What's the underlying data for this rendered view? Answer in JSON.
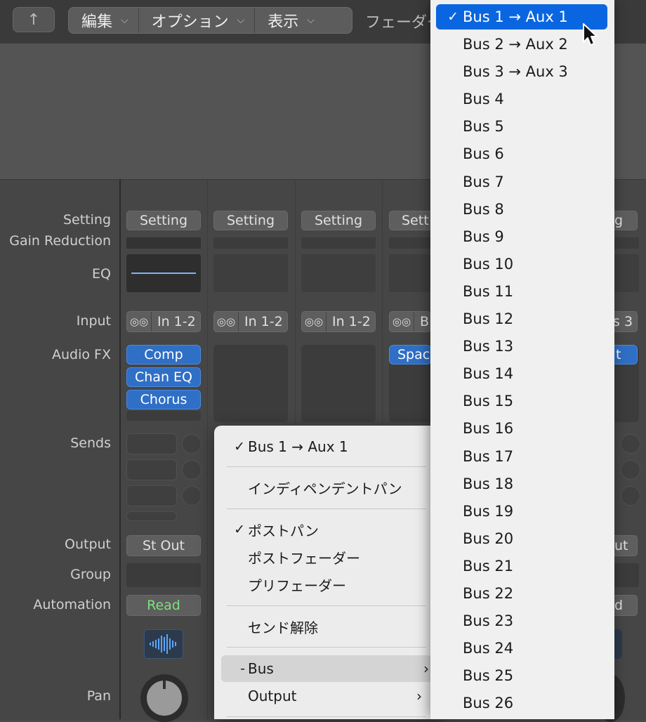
{
  "toolbar": {
    "back_icon": "↑",
    "menus": [
      {
        "label": "編集"
      },
      {
        "label": "オプション"
      },
      {
        "label": "表示"
      }
    ],
    "fader_label": "フェーダー"
  },
  "row_labels": {
    "setting": "Setting",
    "gain_reduction": "Gain Reduction",
    "eq": "EQ",
    "input": "Input",
    "audio_fx": "Audio FX",
    "sends": "Sends",
    "output": "Output",
    "group": "Group",
    "automation": "Automation",
    "pan": "Pan"
  },
  "strips": {
    "s1": {
      "setting": "Setting",
      "input": "In 1-2",
      "fx": [
        "Comp",
        "Chan EQ",
        "Chorus"
      ],
      "output": "St Out",
      "automation": "Read"
    },
    "s2": {
      "setting": "Setting",
      "input": "In 1-2"
    },
    "s3": {
      "setting": "Setting",
      "input": "In 1-2"
    },
    "s4": {
      "setting": "Setting",
      "input": "B",
      "fx": "Space"
    },
    "s5": {
      "setting": "g",
      "input": "s 3",
      "fx": "t",
      "output": "ut",
      "automation": "d"
    }
  },
  "context_menu": {
    "send_dest": "Bus 1 → Aux 1",
    "independent_pan": "インディペンデントパン",
    "post_pan": "ポストパン",
    "post_fader": "ポストフェーダー",
    "pre_fader": "プリフェーダー",
    "remove_send": "センド解除",
    "bus": "Bus",
    "bus_prefix": "-",
    "output": "Output",
    "check": "✓",
    "submenu_arrow": "›"
  },
  "bus_menu": {
    "selected": "Bus 1 → Aux 1",
    "items": [
      "Bus 2 → Aux 2",
      "Bus 3 → Aux 3",
      "Bus 4",
      "Bus 5",
      "Bus 6",
      "Bus 7",
      "Bus 8",
      "Bus 9",
      "Bus 10",
      "Bus 11",
      "Bus 12",
      "Bus 13",
      "Bus 14",
      "Bus 15",
      "Bus 16",
      "Bus 17",
      "Bus 18",
      "Bus 19",
      "Bus 20",
      "Bus 21",
      "Bus 22",
      "Bus 23",
      "Bus 24",
      "Bus 25",
      "Bus 26"
    ],
    "check": "✓"
  },
  "colors": {
    "accent": "#0a66e0",
    "fx_blue": "#2f6fc6",
    "read_green": "#7ee07e"
  },
  "icons": {
    "link": "stereo-link-icon",
    "waveform": "waveform-icon",
    "pointer": "mouse-pointer-icon"
  }
}
